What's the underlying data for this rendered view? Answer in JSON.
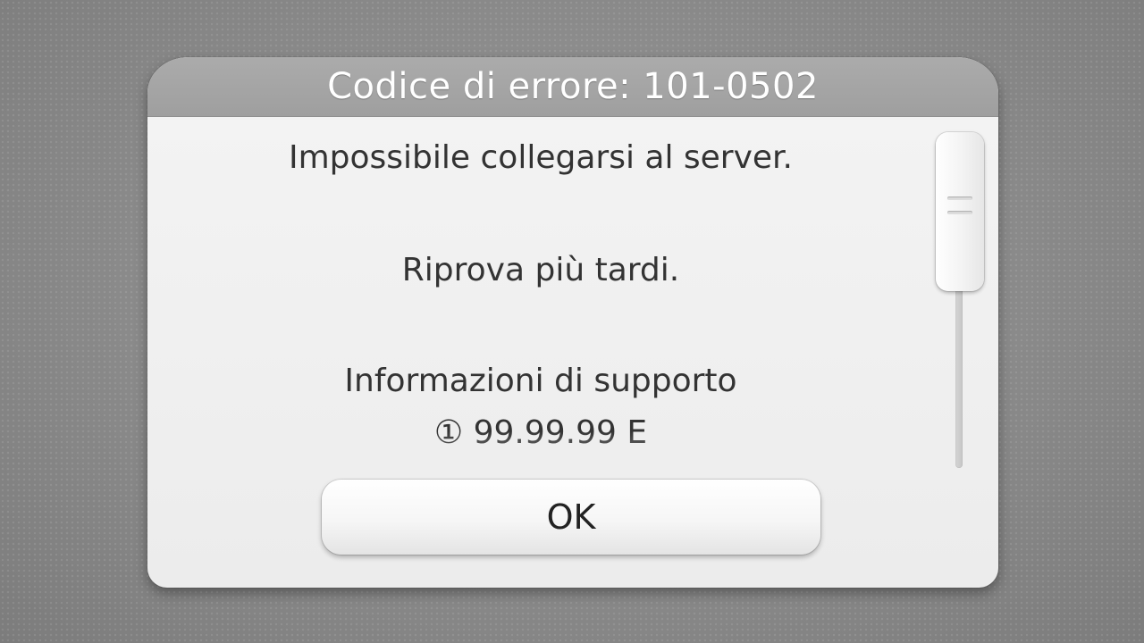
{
  "dialog": {
    "title": "Codice di errore: 101-0502",
    "message": {
      "line1": "Impossibile collegarsi al server.",
      "line2": "Riprova più tardi.",
      "line3": "Informazioni di supporto",
      "line4": "① 99.99.99 E"
    },
    "ok_label": "OK"
  }
}
